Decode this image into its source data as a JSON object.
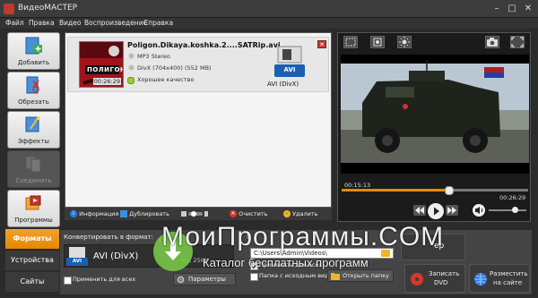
{
  "window": {
    "title": "ВидеоМАСТЕР"
  },
  "menu": [
    "Файл",
    "Правка",
    "Видео",
    "Воспроизведение",
    "Справка"
  ],
  "sidebar": [
    {
      "label": "Добавить",
      "icon": "add-file-icon"
    },
    {
      "label": "Обрезать",
      "icon": "cut-icon"
    },
    {
      "label": "Эффекты",
      "icon": "effects-icon"
    },
    {
      "label": "Соединить",
      "icon": "join-icon",
      "disabled": true
    },
    {
      "label": "Программы",
      "icon": "programs-icon"
    }
  ],
  "file_item": {
    "name": "Poligon.Dikaya.koshka.2....SATRip.avi",
    "audio": "MP3 Stereo",
    "video": "DivX (704x400) (552 MB)",
    "quality": "Хорошее качество",
    "duration": "00:26:29",
    "thumb_text": "ПОЛИГОН",
    "format_label": "AVI (DivX)",
    "format_badge": "AVI",
    "close": "✕"
  },
  "list_toolbar": {
    "info": "Информация",
    "duplicate": "Дублировать",
    "clear": "Очистить",
    "delete": "Удалить"
  },
  "player": {
    "current_time": "00:15:13",
    "total_time": "00:26:29",
    "progress": 0.57
  },
  "bottom_tabs": [
    "Форматы",
    "Устройства",
    "Сайты"
  ],
  "convert": {
    "label": "Конвертировать в формат:",
    "format": "AVI (DivX)",
    "format_badge": "AVI",
    "bitrate_partial": "Hz, 256K",
    "apply_all": "Применить для всех",
    "params": "Параметры",
    "path": "C:\\Users\\Admin\\Videos\\",
    "path_label_partial": "П",
    "apply_all2": "Применить для всех",
    "same_folder": "Папка с исходным видео",
    "open_folder": "Открыть папку",
    "burn_dvd_1": "Записать",
    "burn_dvd_2": "DVD",
    "publish_1": "Разместить",
    "publish_2": "на сайте",
    "convert_partial": "ер"
  },
  "watermark": {
    "line1": "МоиПрограммы.COM",
    "line2": "Каталог бесплатных программ"
  }
}
